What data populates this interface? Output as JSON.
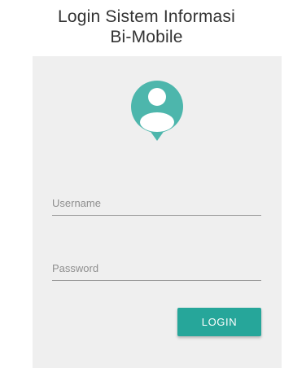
{
  "header": {
    "title_line1": "Login Sistem Informasi",
    "title_line2": "Bi-Mobile"
  },
  "form": {
    "username_placeholder": "Username",
    "username_value": "",
    "password_placeholder": "Password",
    "password_value": "",
    "login_label": "LOGIN"
  },
  "icons": {
    "avatar": "user-pin-icon"
  },
  "colors": {
    "accent": "#26a69a",
    "avatar": "#4db6ac",
    "card_background": "#efefef",
    "title_text": "#333333"
  }
}
